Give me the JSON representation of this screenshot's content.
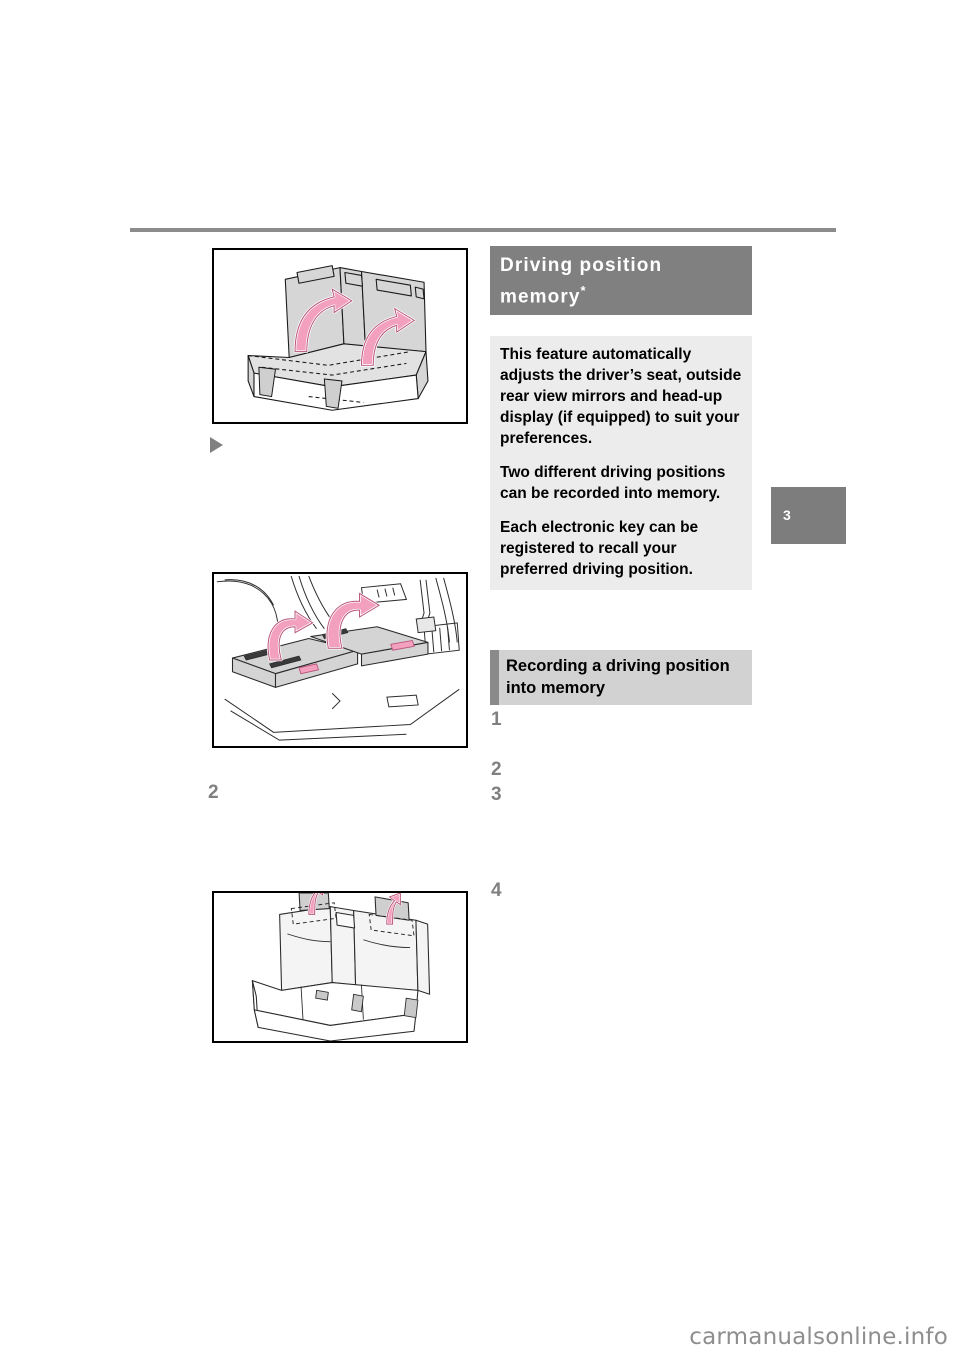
{
  "page": {
    "chapter_tab": "3",
    "watermark": "carmanualsonline.info"
  },
  "left_column": {
    "illustration_1": {
      "name": "rear-seatbacks-raising",
      "description": "Rear bench seat with two pink curved arrows showing the seatbacks being raised upright"
    },
    "bullet_marker": "▶",
    "illustration_2": {
      "name": "cargo-area-seatback-straps",
      "description": "Cargo area view of folded rear seatbacks with pink curved arrows indicating pulling the release straps"
    },
    "step_marker": "2",
    "illustration_3": {
      "name": "rear-head-restraints-raising",
      "description": "Rear seat with pink arrows showing the head restraints being raised"
    }
  },
  "right_column": {
    "section_heading": {
      "text": "Driving position memory",
      "footnote_marker": "*"
    },
    "info_box": {
      "paragraphs": [
        "This feature automatically adjusts the driver’s seat, outside rear view mirrors and head-up display (if equipped) to suit your preferences.",
        "Two different driving positions can be recorded into memory.",
        "Each electronic key can be registered to recall your preferred driving position."
      ]
    },
    "sub_heading": "Recording a driving position into memory",
    "steps": [
      "1",
      "2",
      "3",
      "4"
    ]
  },
  "colors": {
    "section_heading_bg": "#808080",
    "sub_heading_bg": "#d2d2d2",
    "sub_heading_bar": "#8a8a8a",
    "info_box_bg": "#ececec",
    "rule": "#8c8c8c",
    "step_number": "#808080",
    "arrow_pink": "#f2a0bd",
    "illustration_fill": "#d4d4d4"
  }
}
